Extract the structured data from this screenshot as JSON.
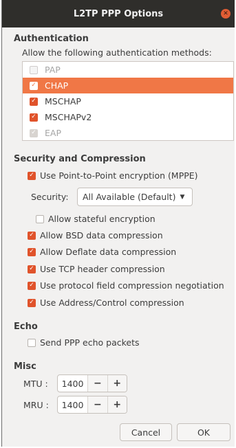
{
  "window": {
    "title": "L2TP PPP Options"
  },
  "authentication": {
    "title": "Authentication",
    "subtitle": "Allow the following authentication methods:",
    "methods": [
      {
        "label": "PAP",
        "checked": false,
        "disabled": true
      },
      {
        "label": "CHAP",
        "checked": true,
        "selected": true
      },
      {
        "label": "MSCHAP",
        "checked": true
      },
      {
        "label": "MSCHAPv2",
        "checked": true
      },
      {
        "label": "EAP",
        "checked": true,
        "disabled": true
      }
    ]
  },
  "security": {
    "title": "Security and Compression",
    "mppe_label": "Use Point-to-Point encryption (MPPE)",
    "security_label": "Security:",
    "security_value": "All Available (Default)",
    "stateful_label": "Allow stateful encryption",
    "bsd_label": "Allow BSD data compression",
    "deflate_label": "Allow Deflate data compression",
    "tcp_label": "Use TCP header compression",
    "protocol_label": "Use protocol field compression negotiation",
    "address_label": "Use Address/Control compression"
  },
  "echo": {
    "title": "Echo",
    "send_label": "Send PPP echo packets"
  },
  "misc": {
    "title": "Misc",
    "mtu_label": "MTU :",
    "mtu_value": "1400",
    "mru_label": "MRU :",
    "mru_value": "1400",
    "minus": "−",
    "plus": "+"
  },
  "buttons": {
    "cancel": "Cancel",
    "ok": "OK"
  },
  "icons": {
    "close": "✕",
    "check": "✓",
    "dropdown": "▼"
  },
  "colors": {
    "accent": "#f07746",
    "check": "#e0532b",
    "titlebar": "#2f2e2b"
  }
}
